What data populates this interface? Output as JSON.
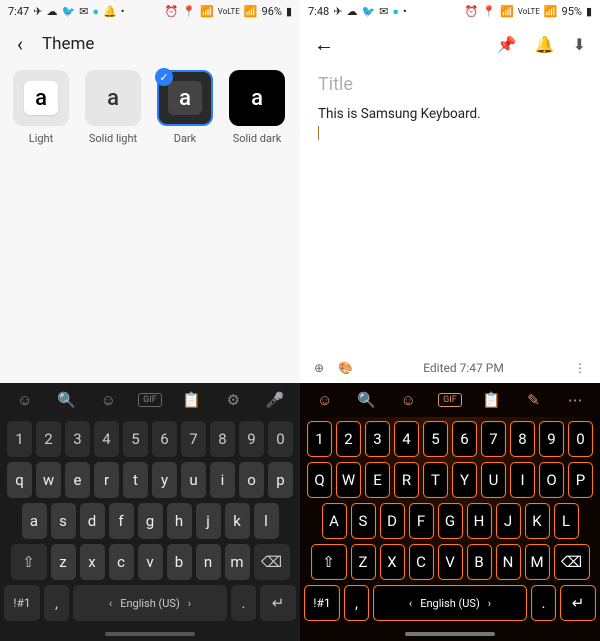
{
  "left": {
    "status": {
      "time": "7:47",
      "battery": "96%"
    },
    "appbar": {
      "title": "Theme"
    },
    "themes": [
      {
        "key": "light",
        "label": "Light",
        "glyph": "a",
        "selected": false
      },
      {
        "key": "solidlight",
        "label": "Solid light",
        "glyph": "a",
        "selected": false
      },
      {
        "key": "dark",
        "label": "Dark",
        "glyph": "a",
        "selected": true
      },
      {
        "key": "soliddark",
        "label": "Solid dark",
        "glyph": "a",
        "selected": false
      }
    ],
    "keyboard": {
      "toolbar_icons": [
        "emoji",
        "search",
        "sticker",
        "gif",
        "clipboard",
        "settings",
        "voice"
      ],
      "rows": {
        "num": [
          "1",
          "2",
          "3",
          "4",
          "5",
          "6",
          "7",
          "8",
          "9",
          "0"
        ],
        "top": [
          "q",
          "w",
          "e",
          "r",
          "t",
          "y",
          "u",
          "i",
          "o",
          "p"
        ],
        "home": [
          "a",
          "s",
          "d",
          "f",
          "g",
          "h",
          "j",
          "k",
          "l"
        ],
        "bot": [
          "z",
          "x",
          "c",
          "v",
          "b",
          "n",
          "m"
        ]
      },
      "shift": "⇧",
      "bksp": "⌫",
      "sym": "!#1",
      "comma": ",",
      "lang": "English (US)",
      "period": ".",
      "enter": "↵",
      "langL": "‹",
      "langR": "›"
    }
  },
  "right": {
    "status": {
      "time": "7:48",
      "battery": "95%"
    },
    "note": {
      "title_placeholder": "Title",
      "body": "This is Samsung Keyboard.",
      "edited": "Edited 7:47 PM"
    },
    "keyboard": {
      "toolbar_icons": [
        "emoji",
        "search",
        "sticker",
        "gif",
        "clipboard",
        "pen",
        "more"
      ],
      "rows": {
        "num": [
          "1",
          "2",
          "3",
          "4",
          "5",
          "6",
          "7",
          "8",
          "9",
          "0"
        ],
        "top": [
          "Q",
          "W",
          "E",
          "R",
          "T",
          "Y",
          "U",
          "I",
          "O",
          "P"
        ],
        "home": [
          "A",
          "S",
          "D",
          "F",
          "G",
          "H",
          "J",
          "K",
          "L"
        ],
        "bot": [
          "Z",
          "X",
          "C",
          "V",
          "B",
          "N",
          "M"
        ]
      },
      "shift": "⇧",
      "bksp": "⌫",
      "sym": "!#1",
      "comma": ",",
      "lang": "English (US)",
      "period": ".",
      "enter": "↵",
      "langL": "‹",
      "langR": "›"
    }
  },
  "status_icons": {
    "telegram": "✈",
    "chat": "☁",
    "twitter": "🐦",
    "mail": "✉",
    "badge": "●",
    "bell": "🔔",
    "alarm": "⏰",
    "location": "📍",
    "wifi": "📶",
    "lte": "LTE",
    "signal": "▮",
    "batt": "▮"
  }
}
